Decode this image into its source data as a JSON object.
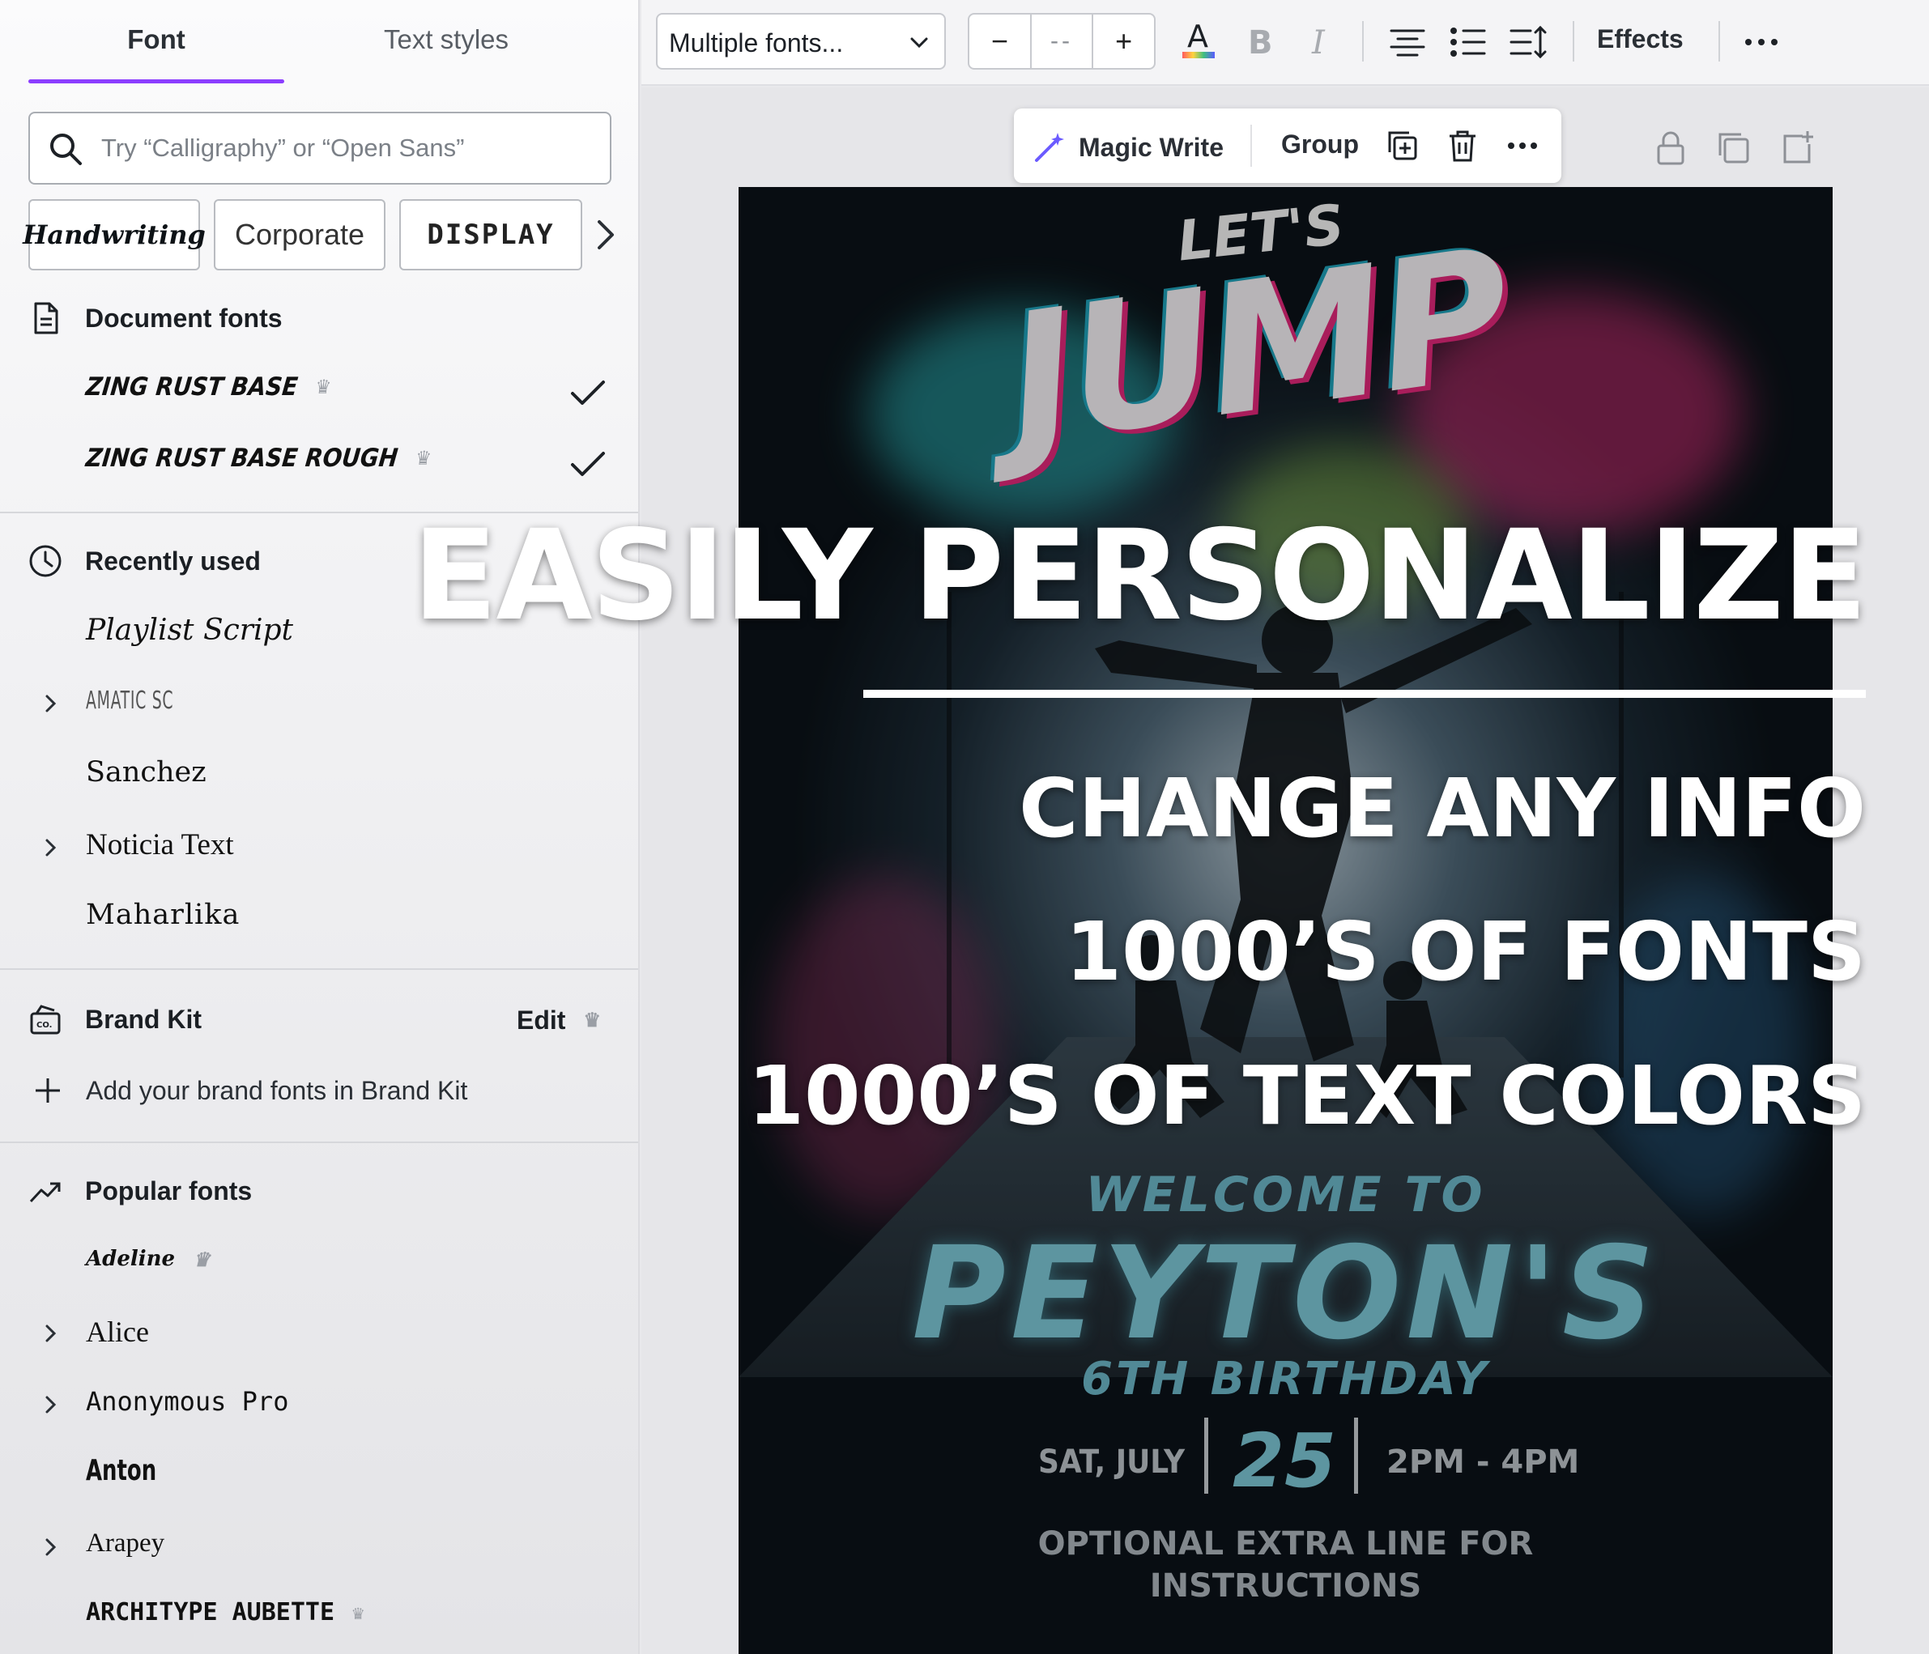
{
  "panel": {
    "tabs": [
      {
        "label": "Font"
      },
      {
        "label": "Text styles"
      }
    ],
    "search": {
      "placeholder": "Try “Calligraphy” or “Open Sans”"
    },
    "chips": [
      {
        "label": "Handwriting"
      },
      {
        "label": "Corporate"
      },
      {
        "label": "DISPLAY"
      }
    ],
    "document_fonts": {
      "title": "Document fonts",
      "items": [
        {
          "label": "ZING RUST BASE"
        },
        {
          "label": "ZING RUST BASE ROUGH"
        }
      ]
    },
    "recently_used": {
      "title": "Recently used",
      "items": [
        {
          "label": "Playlist Script"
        },
        {
          "label": "AMATIC SC"
        },
        {
          "label": "Sanchez"
        },
        {
          "label": "Noticia Text"
        },
        {
          "label": "Maharlika"
        }
      ]
    },
    "brand_kit": {
      "title": "Brand Kit",
      "edit_label": "Edit",
      "add_label": "Add your brand fonts in Brand Kit"
    },
    "popular_fonts": {
      "title": "Popular fonts",
      "items": [
        {
          "label": "Adeline"
        },
        {
          "label": "Alice"
        },
        {
          "label": "Anonymous Pro"
        },
        {
          "label": "Anton"
        },
        {
          "label": "Arapey"
        },
        {
          "label": "ARCHITYPE AUBETTE"
        }
      ]
    }
  },
  "toolbar": {
    "font_select": "Multiple fonts...",
    "size_minus": "−",
    "size_value": "--",
    "size_plus": "+",
    "effects_label": "Effects"
  },
  "context_bar": {
    "magic_write": "Magic Write",
    "group": "Group"
  },
  "poster": {
    "lets": "LET'S",
    "jump": "JUMP",
    "welcome": "WELCOME TO",
    "name": "PEYTON'S",
    "birthday": "6TH BIRTHDAY",
    "day": "SAT, JULY",
    "date": "25",
    "time": "2PM - 4PM",
    "extra_line1": "OPTIONAL EXTRA LINE FOR",
    "extra_line2": "INSTRUCTIONS"
  },
  "overlay": {
    "title": "EASILY PERSONALIZE",
    "lines": [
      "CHANGE ANY INFO",
      "1000’S OF FONTS",
      "1000’S OF TEXT COLORS"
    ]
  },
  "colors": {
    "accent": "#8b3dff",
    "overlay_text": "#ffffff"
  }
}
